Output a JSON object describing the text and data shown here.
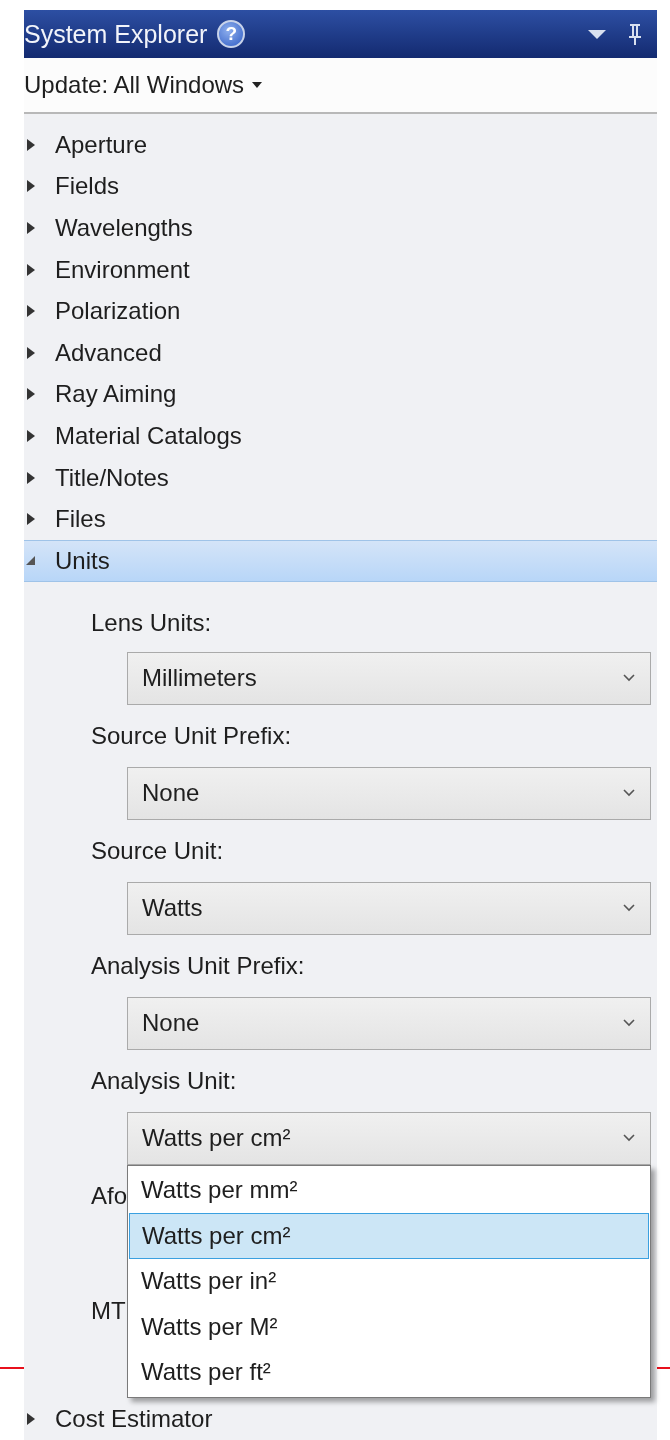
{
  "window": {
    "title": "System Explorer",
    "help_glyph": "?"
  },
  "update_menu": {
    "label": "Update: All Windows"
  },
  "tree": [
    {
      "label": "Aperture",
      "expanded": false,
      "selected": false
    },
    {
      "label": "Fields",
      "expanded": false,
      "selected": false
    },
    {
      "label": "Wavelengths",
      "expanded": false,
      "selected": false
    },
    {
      "label": "Environment",
      "expanded": false,
      "selected": false
    },
    {
      "label": "Polarization",
      "expanded": false,
      "selected": false
    },
    {
      "label": "Advanced",
      "expanded": false,
      "selected": false
    },
    {
      "label": "Ray Aiming",
      "expanded": false,
      "selected": false
    },
    {
      "label": "Material Catalogs",
      "expanded": false,
      "selected": false
    },
    {
      "label": "Title/Notes",
      "expanded": false,
      "selected": false
    },
    {
      "label": "Files",
      "expanded": false,
      "selected": false
    },
    {
      "label": "Units",
      "expanded": true,
      "selected": true,
      "children": [
        {
          "label": "Lens Units:",
          "value": "Millimeters"
        },
        {
          "label": "Source Unit Prefix:",
          "value": "None"
        },
        {
          "label": "Source Unit:",
          "value": "Watts"
        },
        {
          "label": "Analysis Unit Prefix:",
          "value": "None"
        },
        {
          "label": "Analysis Unit:",
          "value": "Watts per cm²",
          "open": true,
          "options": [
            {
              "label": "Watts per mm²",
              "selected": false
            },
            {
              "label": "Watts per cm²",
              "selected": true
            },
            {
              "label": "Watts per in²",
              "selected": false
            },
            {
              "label": "Watts per M²",
              "selected": false
            },
            {
              "label": "Watts per ft²",
              "selected": false
            }
          ]
        },
        {
          "label": "Afo"
        },
        {
          "label": "MT"
        }
      ]
    },
    {
      "label": "Cost Estimator",
      "expanded": false,
      "selected": false
    }
  ]
}
